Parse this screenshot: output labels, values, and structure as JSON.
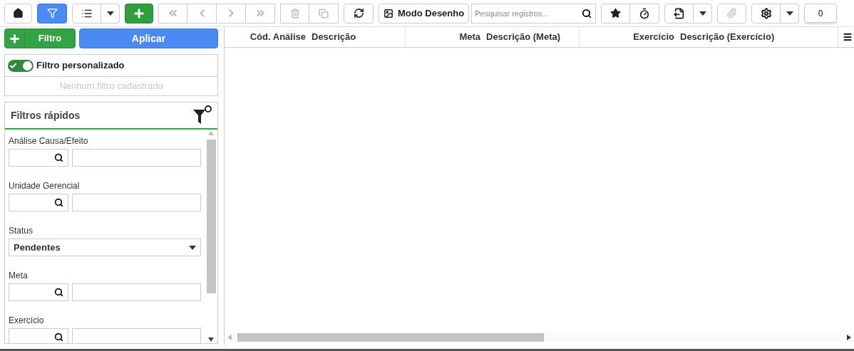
{
  "toolbar": {
    "filter_toggle": {
      "selected": true
    },
    "navigation": [
      {
        "disabled": true
      },
      {
        "disabled": true
      },
      {
        "disabled": true
      },
      {
        "disabled": true
      }
    ],
    "record_actions": [
      {
        "disabled": true
      },
      {
        "disabled": true
      }
    ],
    "draw_mode": {
      "label": "Modo Desenho"
    },
    "search": {
      "placeholder": "Pesquisar registros..."
    },
    "attach": {
      "disabled": true
    },
    "counter": "0"
  },
  "filter_bar": {
    "add_label": "Filtro",
    "apply_label": "Aplicar"
  },
  "custom_filter": {
    "label": "Filtro personalizado",
    "on": true,
    "empty_text": "Nenhum filtro cadastrado"
  },
  "quick_filters": {
    "title": "Filtros rápidos",
    "fields": [
      {
        "kind": "lookup",
        "label": "Análise Causa/Efeito"
      },
      {
        "kind": "lookup",
        "label": "Unidade Gerencial"
      },
      {
        "kind": "select",
        "label": "Status",
        "value": "Pendentes"
      },
      {
        "kind": "lookup",
        "label": "Meta"
      },
      {
        "kind": "lookup",
        "label": "Exercício"
      }
    ]
  },
  "table": {
    "columns": [
      {
        "label": "Cód. Análise",
        "kind": "number"
      },
      {
        "label": "Descrição",
        "kind": "text"
      },
      {
        "label": "Meta",
        "kind": "number"
      },
      {
        "label": "Descrição (Meta)",
        "kind": "text"
      },
      {
        "label": "Exercício",
        "kind": "number"
      },
      {
        "label": "Descrição (Exercício)",
        "kind": "text"
      }
    ]
  }
}
